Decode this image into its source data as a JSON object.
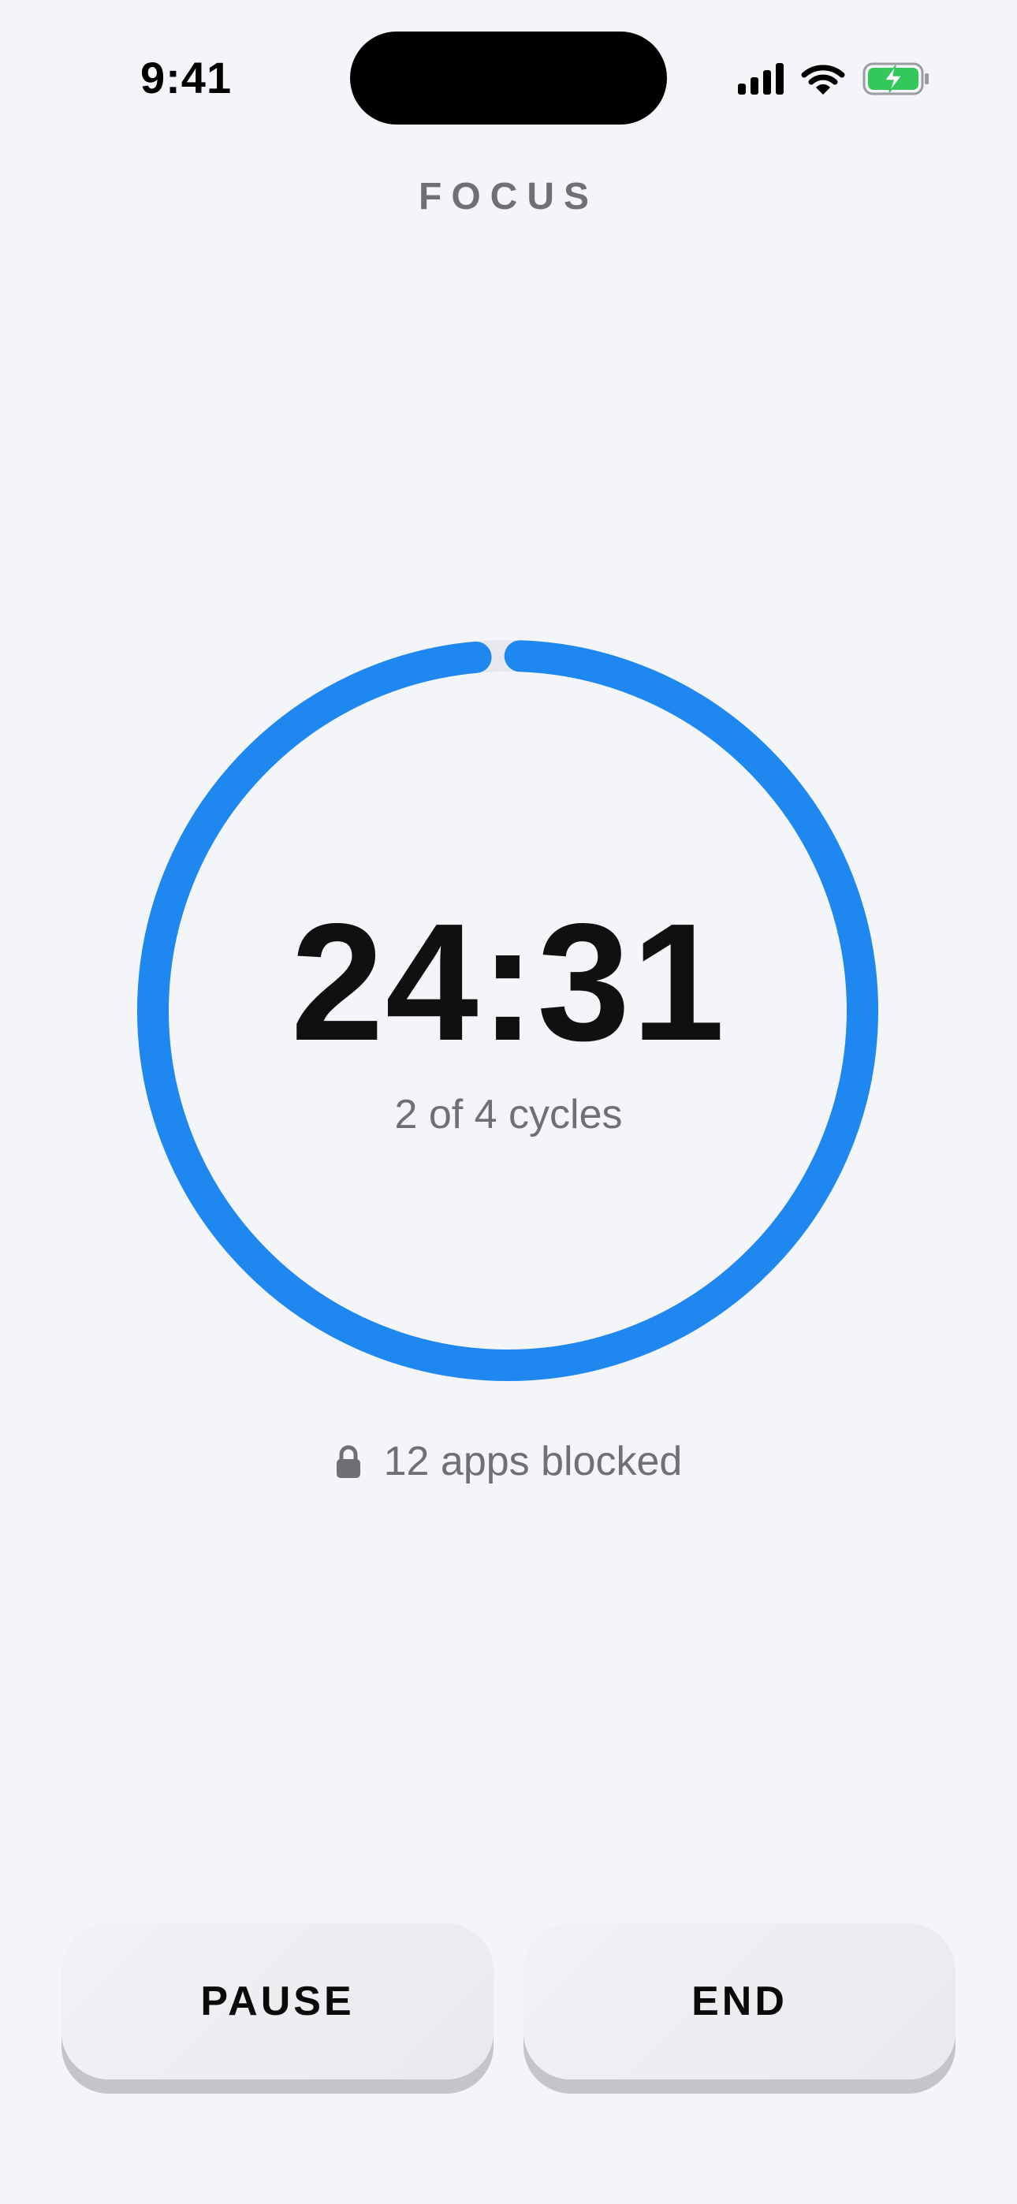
{
  "status_bar": {
    "time": "9:41",
    "icons": [
      "signal-icon",
      "wifi-icon",
      "battery-charging-icon"
    ]
  },
  "header": {
    "title": "FOCUS"
  },
  "timer": {
    "time_remaining": "24:31",
    "cycles_label": "2 of 4 cycles",
    "progress_fraction": 0.98
  },
  "blocked": {
    "icon": "lock-icon",
    "label": "12 apps blocked"
  },
  "buttons": {
    "pause_label": "PAUSE",
    "end_label": "END"
  },
  "colors": {
    "accent": "#1e88f0",
    "background": "#f3f5f8",
    "track": "#e6e8ec",
    "secondary_text": "#6e7075",
    "battery_green": "#34c759"
  }
}
